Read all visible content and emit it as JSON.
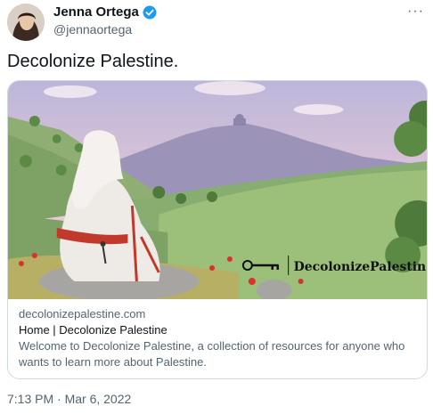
{
  "author": {
    "name": "Jenna Ortega",
    "handle": "@jennaortega",
    "verified_color": "#1d9bf0"
  },
  "more_icon": "···",
  "tweet": {
    "text": "Decolonize Palestine.",
    "timestamp": "7:13 PM · Mar 6, 2022"
  },
  "card": {
    "image_overlay_text": "DecolonizePalestin",
    "domain": "decolonizepalestine.com",
    "title": "Home | Decolonize Palestine",
    "description": "Welcome to Decolonize Palestine, a collection of resources for anyone who wants to learn more about Palestine."
  },
  "colors": {
    "sky": "#c9c3e0",
    "hills": "#7aa36b",
    "dress_accent": "#c0392b",
    "poppy": "#d8322b"
  }
}
